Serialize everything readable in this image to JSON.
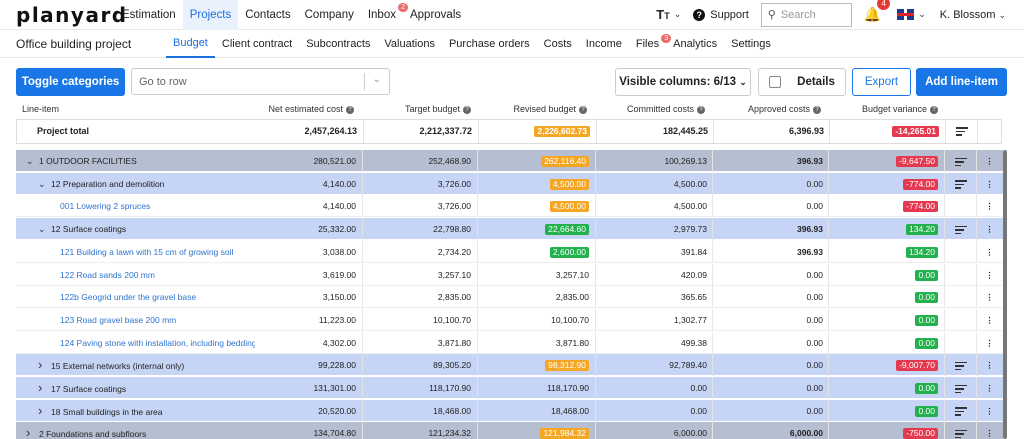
{
  "app": {
    "logo": "planyard"
  },
  "topnav": {
    "items": [
      {
        "label": "Estimation",
        "active": false,
        "badge": ""
      },
      {
        "label": "Projects",
        "active": true,
        "badge": ""
      },
      {
        "label": "Contacts",
        "active": false,
        "badge": ""
      },
      {
        "label": "Company",
        "active": false,
        "badge": ""
      },
      {
        "label": "Inbox",
        "active": false,
        "badge": "2"
      },
      {
        "label": "Approvals",
        "active": false,
        "badge": ""
      }
    ],
    "text_size_icon": "T",
    "support_label": "Support",
    "search_placeholder": "Search",
    "notification_count": "4",
    "user_name": "K. Blossom"
  },
  "subnav": {
    "project_title": "Office building project",
    "tabs": [
      {
        "label": "Budget",
        "active": true,
        "badge": ""
      },
      {
        "label": "Client contract",
        "active": false,
        "badge": ""
      },
      {
        "label": "Subcontracts",
        "active": false,
        "badge": ""
      },
      {
        "label": "Valuations",
        "active": false,
        "badge": ""
      },
      {
        "label": "Purchase orders",
        "active": false,
        "badge": ""
      },
      {
        "label": "Costs",
        "active": false,
        "badge": ""
      },
      {
        "label": "Income",
        "active": false,
        "badge": ""
      },
      {
        "label": "Files",
        "active": false,
        "badge": "3"
      },
      {
        "label": "Analytics",
        "active": false,
        "badge": ""
      },
      {
        "label": "Settings",
        "active": false,
        "badge": ""
      }
    ]
  },
  "toolbar": {
    "toggle_categories": "Toggle categories",
    "goto_placeholder": "Go to row",
    "visible_columns": "Visible columns: 6/13",
    "details": "Details",
    "export": "Export",
    "add_line_item": "Add line-item"
  },
  "columns": {
    "line_item": "Line-item",
    "net_estimated_cost": "Net estimated cost",
    "target_budget": "Target budget",
    "revised_budget": "Revised budget",
    "committed_costs": "Committed costs",
    "approved_costs": "Approved costs",
    "budget_variance": "Budget variance"
  },
  "colors": {
    "accent": "#1976e6",
    "orange": "#f5a623",
    "green": "#22b14c",
    "red": "#e53950"
  },
  "total": {
    "name": "Project total",
    "net": "2,457,264.13",
    "target": "2,212,337.72",
    "revised": "2,226,602.73",
    "committed": "182,445.25",
    "approved": "6,396.93",
    "variance": "-14,265.01"
  },
  "rows": [
    {
      "level": 1,
      "expanded": true,
      "link": false,
      "name": "1 OUTDOOR FACILITIES",
      "net": "280,521.00",
      "target": "252,468.90",
      "revised": "262,116.40",
      "revised_style": "orange",
      "committed": "100,269.13",
      "approved": "396.93",
      "approved_bold": true,
      "variance": "-9,647.50",
      "variance_style": "red",
      "sort": true
    },
    {
      "level": 2,
      "expanded": true,
      "link": false,
      "name": "12 Preparation and demolition",
      "net": "4,140.00",
      "target": "3,726.00",
      "revised": "4,500.00",
      "revised_style": "orange",
      "committed": "4,500.00",
      "approved": "0.00",
      "approved_bold": false,
      "variance": "-774.00",
      "variance_style": "red",
      "sort": true
    },
    {
      "level": 3,
      "expanded": false,
      "link": true,
      "name": "001 Lowering 2 spruces",
      "net": "4,140.00",
      "target": "3,726.00",
      "revised": "4,500.00",
      "revised_style": "orange",
      "committed": "4,500.00",
      "approved": "0.00",
      "approved_bold": false,
      "variance": "-774.00",
      "variance_style": "red",
      "sort": false
    },
    {
      "level": 2,
      "expanded": true,
      "link": false,
      "name": "12 Surface coatings",
      "net": "25,332.00",
      "target": "22,798.80",
      "revised": "22,664.60",
      "revised_style": "green",
      "committed": "2,979.73",
      "approved": "396.93",
      "approved_bold": true,
      "variance": "134.20",
      "variance_style": "green",
      "sort": true
    },
    {
      "level": 3,
      "expanded": false,
      "link": true,
      "name": "121 Building a lawn with 15 cm of growing soil",
      "net": "3,038.00",
      "target": "2,734.20",
      "revised": "2,600.00",
      "revised_style": "green",
      "committed": "391.84",
      "approved": "396.93",
      "approved_bold": true,
      "variance": "134.20",
      "variance_style": "green",
      "sort": false
    },
    {
      "level": 3,
      "expanded": false,
      "link": true,
      "name": "122 Road sands 200 mm",
      "net": "3,619.00",
      "target": "3,257.10",
      "revised": "3,257.10",
      "revised_style": "",
      "committed": "420.09",
      "approved": "0.00",
      "approved_bold": false,
      "variance": "0.00",
      "variance_style": "green",
      "sort": false
    },
    {
      "level": 3,
      "expanded": false,
      "link": true,
      "name": "122b Geogrid under the gravel base",
      "net": "3,150.00",
      "target": "2,835.00",
      "revised": "2,835.00",
      "revised_style": "",
      "committed": "365.65",
      "approved": "0.00",
      "approved_bold": false,
      "variance": "0.00",
      "variance_style": "green",
      "sort": false
    },
    {
      "level": 3,
      "expanded": false,
      "link": true,
      "name": "123 Road gravel base 200 mm",
      "net": "11,223.00",
      "target": "10,100.70",
      "revised": "10,100.70",
      "revised_style": "",
      "committed": "1,302.77",
      "approved": "0.00",
      "approved_bold": false,
      "variance": "0.00",
      "variance_style": "green",
      "sort": false
    },
    {
      "level": 3,
      "expanded": false,
      "link": true,
      "name": "124 Paving stone with installation, including bedding",
      "net": "4,302.00",
      "target": "3,871.80",
      "revised": "3,871.80",
      "revised_style": "",
      "committed": "499.38",
      "approved": "0.00",
      "approved_bold": false,
      "variance": "0.00",
      "variance_style": "green",
      "sort": false
    },
    {
      "level": 2,
      "expanded": false,
      "link": false,
      "name": "15 External networks (internal only)",
      "net": "99,228.00",
      "target": "89,305.20",
      "revised": "98,312.90",
      "revised_style": "orange",
      "committed": "92,789.40",
      "approved": "0.00",
      "approved_bold": false,
      "variance": "-9,007.70",
      "variance_style": "red",
      "sort": true
    },
    {
      "level": 2,
      "expanded": false,
      "link": false,
      "name": "17 Surface coatings",
      "net": "131,301.00",
      "target": "118,170.90",
      "revised": "118,170.90",
      "revised_style": "",
      "committed": "0.00",
      "approved": "0.00",
      "approved_bold": false,
      "variance": "0.00",
      "variance_style": "green",
      "sort": true
    },
    {
      "level": 2,
      "expanded": false,
      "link": false,
      "name": "18 Small buildings in the area",
      "net": "20,520.00",
      "target": "18,468.00",
      "revised": "18,468.00",
      "revised_style": "",
      "committed": "0.00",
      "approved": "0.00",
      "approved_bold": false,
      "variance": "0.00",
      "variance_style": "green",
      "sort": true
    },
    {
      "level": 1,
      "expanded": false,
      "link": false,
      "name": "2 Foundations and subfloors",
      "net": "134,704.80",
      "target": "121,234.32",
      "revised": "121,984.32",
      "revised_style": "orange",
      "committed": "6,000.00",
      "approved": "6,000.00",
      "approved_bold": true,
      "variance": "-750.00",
      "variance_style": "red",
      "sort": true
    }
  ]
}
